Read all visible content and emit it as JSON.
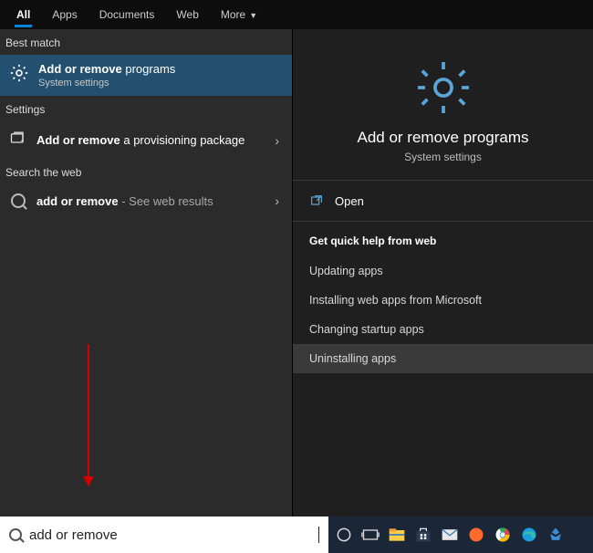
{
  "tabs": {
    "all": "All",
    "apps": "Apps",
    "documents": "Documents",
    "web": "Web",
    "more": "More"
  },
  "sections": {
    "best": "Best match",
    "settings": "Settings",
    "web": "Search the web"
  },
  "best_match": {
    "title_bold": "Add or remove",
    "title_rest": " programs",
    "subtitle": "System settings"
  },
  "settings_item": {
    "title_bold": "Add or remove",
    "title_rest": " a provisioning package"
  },
  "web_item": {
    "title_bold": "add or remove",
    "title_rest": " - See web results"
  },
  "preview": {
    "title": "Add or remove programs",
    "subtitle": "System settings",
    "open": "Open",
    "help_header": "Get quick help from web",
    "help": {
      "h1": "Updating apps",
      "h2": "Installing web apps from Microsoft",
      "h3": "Changing startup apps",
      "h4": "Uninstalling apps"
    }
  },
  "search": {
    "value": "add or remove"
  }
}
